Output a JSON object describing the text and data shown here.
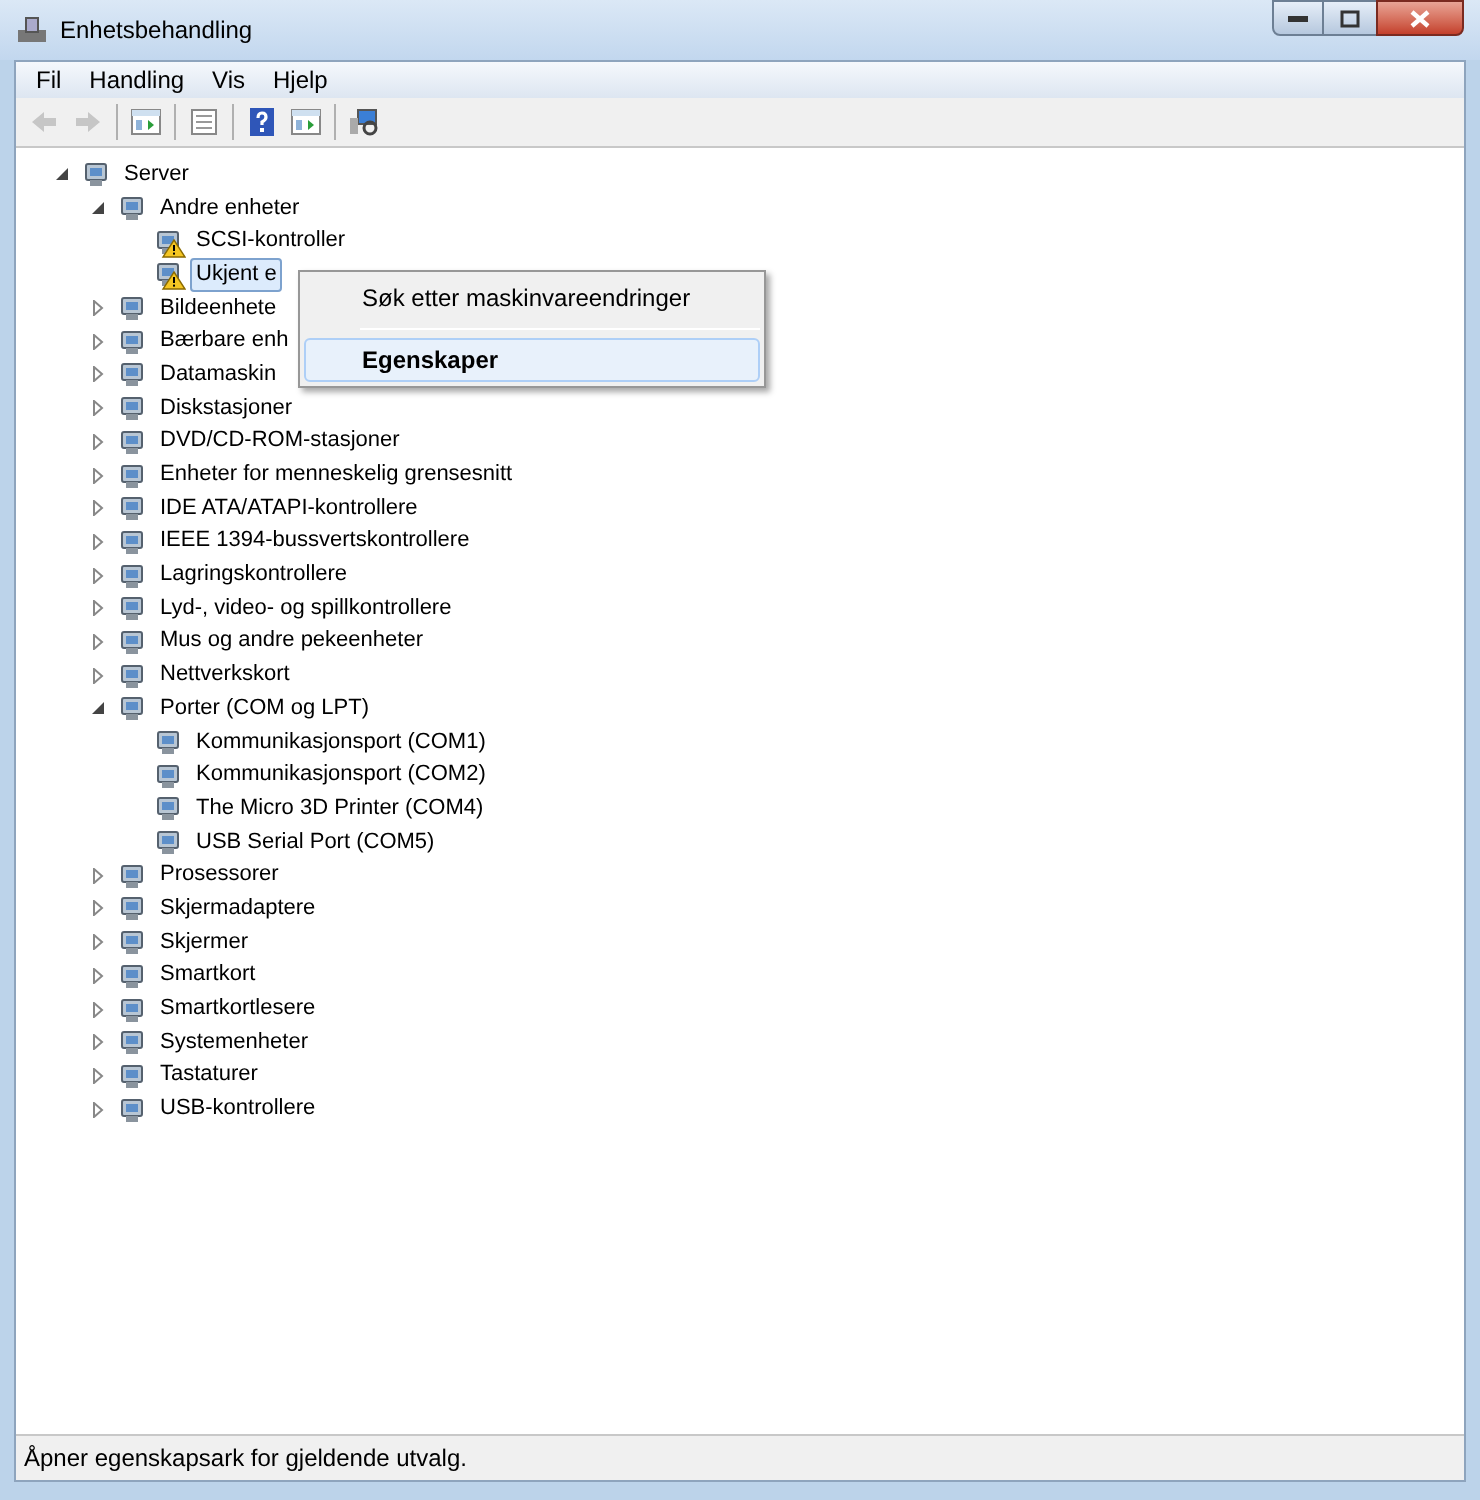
{
  "window": {
    "title": "Enhetsbehandling"
  },
  "menu": [
    "Fil",
    "Handling",
    "Vis",
    "Hjelp"
  ],
  "toolbar": [
    {
      "disabled": true
    },
    {
      "disabled": true
    },
    {
      "disabled": false
    },
    {
      "disabled": false
    },
    {
      "disabled": false
    },
    {
      "disabled": false
    },
    {
      "disabled": false
    }
  ],
  "tree": [
    {
      "label": "Server",
      "expanded": true,
      "selected": false,
      "warning": false,
      "children": [
        {
          "label": "Andre enheter",
          "expanded": true,
          "selected": false,
          "warning": false,
          "children": [
            {
              "label": "SCSI-kontroller",
              "selected": false,
              "warning": true
            },
            {
              "label": "Ukjent e",
              "selected": true,
              "warning": true
            }
          ]
        },
        {
          "label": "Bildeenhete",
          "expanded": false,
          "selected": false,
          "warning": false
        },
        {
          "label": "Bærbare enh",
          "expanded": false,
          "selected": false,
          "warning": false
        },
        {
          "label": "Datamaskin",
          "expanded": false,
          "selected": false,
          "warning": false
        },
        {
          "label": "Diskstasjoner",
          "expanded": false,
          "selected": false,
          "warning": false
        },
        {
          "label": "DVD/CD-ROM-stasjoner",
          "expanded": false,
          "selected": false,
          "warning": false
        },
        {
          "label": "Enheter for menneskelig grensesnitt",
          "expanded": false,
          "selected": false,
          "warning": false
        },
        {
          "label": "IDE ATA/ATAPI-kontrollere",
          "expanded": false,
          "selected": false,
          "warning": false
        },
        {
          "label": "IEEE 1394-bussvertskontrollere",
          "expanded": false,
          "selected": false,
          "warning": false
        },
        {
          "label": "Lagringskontrollere",
          "expanded": false,
          "selected": false,
          "warning": false
        },
        {
          "label": "Lyd-, video- og spillkontrollere",
          "expanded": false,
          "selected": false,
          "warning": false
        },
        {
          "label": "Mus og andre pekeenheter",
          "expanded": false,
          "selected": false,
          "warning": false
        },
        {
          "label": "Nettverkskort",
          "expanded": false,
          "selected": false,
          "warning": false
        },
        {
          "label": "Porter (COM og LPT)",
          "expanded": true,
          "selected": false,
          "warning": false,
          "children": [
            {
              "label": "Kommunikasjonsport (COM1)",
              "selected": false,
              "warning": false
            },
            {
              "label": "Kommunikasjonsport (COM2)",
              "selected": false,
              "warning": false
            },
            {
              "label": "The Micro 3D Printer (COM4)",
              "selected": false,
              "warning": false
            },
            {
              "label": "USB Serial Port (COM5)",
              "selected": false,
              "warning": false
            }
          ]
        },
        {
          "label": "Prosessorer",
          "expanded": false,
          "selected": false,
          "warning": false
        },
        {
          "label": "Skjermadaptere",
          "expanded": false,
          "selected": false,
          "warning": false
        },
        {
          "label": "Skjermer",
          "expanded": false,
          "selected": false,
          "warning": false
        },
        {
          "label": "Smartkort",
          "expanded": false,
          "selected": false,
          "warning": false
        },
        {
          "label": "Smartkortlesere",
          "expanded": false,
          "selected": false,
          "warning": false
        },
        {
          "label": "Systemenheter",
          "expanded": false,
          "selected": false,
          "warning": false
        },
        {
          "label": "Tastaturer",
          "expanded": false,
          "selected": false,
          "warning": false
        },
        {
          "label": "USB-kontrollere",
          "expanded": false,
          "selected": false,
          "warning": false
        }
      ]
    }
  ],
  "context_menu": [
    {
      "kind": "item",
      "label": "Søk etter maskinvareendringer",
      "selected": false,
      "default": false
    },
    {
      "kind": "separator"
    },
    {
      "kind": "item",
      "label": "Egenskaper",
      "selected": true,
      "default": true
    }
  ],
  "status_bar": "Åpner egenskapsark for gjeldende utvalg."
}
